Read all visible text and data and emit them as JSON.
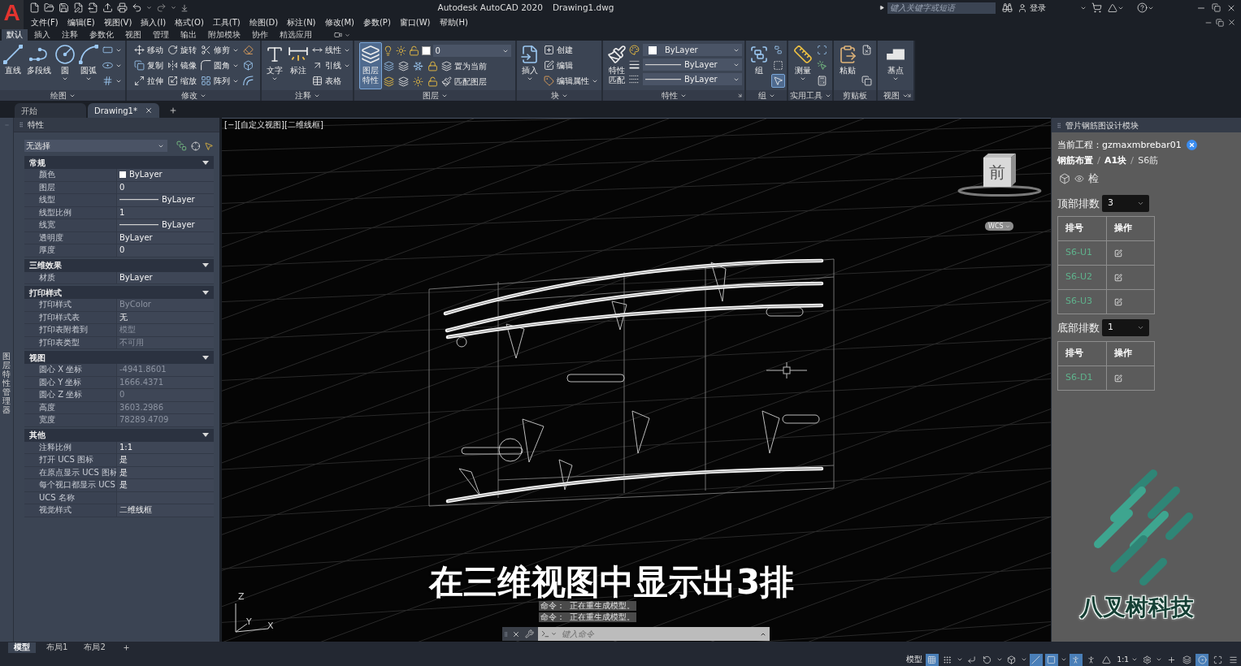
{
  "app_menu": {
    "label": "A"
  },
  "title_bar": {
    "title": "Autodesk AutoCAD 2020",
    "file_name": "Drawing1.dwg",
    "search": {
      "placeholder": "键入关键字或短语"
    },
    "sign_in": "登录"
  },
  "menu_bar": [
    "文件(F)",
    "编辑(E)",
    "视图(V)",
    "插入(I)",
    "格式(O)",
    "工具(T)",
    "绘图(D)",
    "标注(N)",
    "修改(M)",
    "参数(P)",
    "窗口(W)",
    "帮助(H)"
  ],
  "ribbon": {
    "tabs": [
      {
        "label": "默认",
        "selected": true
      },
      {
        "label": "插入",
        "selected": false
      },
      {
        "label": "注释",
        "selected": false
      },
      {
        "label": "参数化",
        "selected": false
      },
      {
        "label": "视图",
        "selected": false
      },
      {
        "label": "管理",
        "selected": false
      },
      {
        "label": "输出",
        "selected": false
      },
      {
        "label": "附加模块",
        "selected": false
      },
      {
        "label": "协作",
        "selected": false
      },
      {
        "label": "精选应用",
        "selected": false
      }
    ],
    "groups": [
      {
        "label": "绘图",
        "dropdown": true,
        "launcher": false,
        "columns": [
          {
            "kind": "large",
            "label": "直线",
            "dropdown": false,
            "selected": false
          },
          {
            "kind": "large",
            "label": "多段线",
            "dropdown": false,
            "selected": false
          },
          {
            "kind": "large",
            "label": "圆",
            "dropdown": true,
            "selected": false
          },
          {
            "kind": "large",
            "label": "圆弧",
            "dropdown": true,
            "selected": false
          },
          {
            "kind": "stack",
            "items": [
              {
                "dropdown": true
              },
              {
                "dropdown": true
              },
              {
                "dropdown": true
              }
            ]
          }
        ]
      },
      {
        "label": "修改",
        "dropdown": true,
        "launcher": false,
        "columns": [
          {
            "kind": "stack",
            "items": [
              {
                "label": "移动",
                "dropdown": false
              },
              {
                "label": "复制",
                "dropdown": false
              },
              {
                "label": "拉伸",
                "dropdown": false
              }
            ]
          },
          {
            "kind": "stack",
            "items": [
              {
                "label": "旋转",
                "dropdown": false
              },
              {
                "label": "镜像",
                "dropdown": false
              },
              {
                "label": "缩放",
                "dropdown": false
              }
            ]
          },
          {
            "kind": "stack",
            "items": [
              {
                "label": "修剪",
                "dropdown": true
              },
              {
                "label": "圆角",
                "dropdown": true
              },
              {
                "label": "阵列",
                "dropdown": true
              }
            ]
          },
          {
            "kind": "stack",
            "items": [
              {
                "dropdown": false
              },
              {
                "dropdown": false
              },
              {
                "dropdown": false
              }
            ]
          }
        ]
      },
      {
        "label": "注释",
        "dropdown": true,
        "launcher": false,
        "columns": [
          {
            "kind": "large",
            "label": "文字",
            "dropdown": true,
            "selected": false
          },
          {
            "kind": "large",
            "label": "标注",
            "dropdown": false,
            "selected": false
          },
          {
            "kind": "stack",
            "items": [
              {
                "label": "线性",
                "dropdown": true
              },
              {
                "label": "引线",
                "dropdown": true
              },
              {
                "label": "表格",
                "dropdown": false
              }
            ]
          }
        ]
      },
      {
        "label": "图层",
        "dropdown": true,
        "launcher": false,
        "columns": [
          {
            "kind": "large",
            "label": "图层特性",
            "dropdown": false,
            "selected": true
          },
          {
            "kind": "layers",
            "current": "0",
            "actions": [
              "置为当前",
              "匹配图层"
            ]
          }
        ]
      },
      {
        "label": "块",
        "dropdown": true,
        "launcher": false,
        "columns": [
          {
            "kind": "large",
            "label": "插入",
            "dropdown": true,
            "selected": false
          },
          {
            "kind": "stack",
            "items": [
              {
                "label": "创建",
                "dropdown": false
              },
              {
                "label": "编辑",
                "dropdown": false
              },
              {
                "label": "编辑属性",
                "dropdown": true
              }
            ]
          }
        ]
      },
      {
        "label": "特性",
        "dropdown": true,
        "launcher": true,
        "columns": [
          {
            "kind": "large",
            "label": "特性匹配",
            "dropdown": false,
            "selected": false
          },
          {
            "kind": "combos",
            "items": [
              {
                "kind": "color",
                "value": "ByLayer"
              },
              {
                "kind": "line",
                "value": "ByLayer"
              },
              {
                "kind": "line",
                "value": "ByLayer"
              }
            ]
          }
        ]
      },
      {
        "label": "组",
        "dropdown": true,
        "launcher": false,
        "columns": [
          {
            "kind": "large",
            "label": "组",
            "dropdown": false,
            "selected": false
          },
          {
            "kind": "stack",
            "items": [
              {
                "dropdown": false,
                "selected": false
              },
              {
                "dropdown": false,
                "selected": false
              },
              {
                "dropdown": false,
                "selected": true
              }
            ]
          }
        ]
      },
      {
        "label": "实用工具",
        "dropdown": true,
        "launcher": false,
        "columns": [
          {
            "kind": "large",
            "label": "测量",
            "dropdown": true,
            "selected": false
          },
          {
            "kind": "stack",
            "items": [
              {
                "dropdown": false
              },
              {
                "dropdown": false
              },
              {
                "dropdown": false
              }
            ]
          }
        ]
      },
      {
        "label": "剪贴板",
        "dropdown": false,
        "launcher": false,
        "columns": [
          {
            "kind": "large",
            "label": "粘贴",
            "dropdown": false,
            "selected": false
          },
          {
            "kind": "stack",
            "items": [
              {
                "dropdown": false
              },
              {
                "dropdown": false
              }
            ]
          }
        ]
      },
      {
        "label": "视图",
        "dropdown": true,
        "launcher": true,
        "columns": [
          {
            "kind": "large",
            "label": "基点",
            "dropdown": true,
            "selected": false
          }
        ]
      }
    ]
  },
  "file_tabs": [
    {
      "label": "开始",
      "selected": false,
      "closable": false
    },
    {
      "label": "Drawing1*",
      "selected": true,
      "closable": true
    }
  ],
  "side_strip": {
    "label": "图层特性管理器"
  },
  "properties": {
    "title": "特性",
    "selection": "无选择",
    "sections": [
      {
        "title": "常规",
        "expanded": true,
        "rows": [
          {
            "label": "颜色",
            "value": "ByLayer",
            "kind": "swatch",
            "disabled": false
          },
          {
            "label": "图层",
            "value": "0",
            "kind": "text",
            "disabled": false
          },
          {
            "label": "线型",
            "value": "ByLayer",
            "kind": "line",
            "disabled": false
          },
          {
            "label": "线型比例",
            "value": "1",
            "kind": "text",
            "disabled": false
          },
          {
            "label": "线宽",
            "value": "ByLayer",
            "kind": "line",
            "disabled": false
          },
          {
            "label": "透明度",
            "value": "ByLayer",
            "kind": "text",
            "disabled": false
          },
          {
            "label": "厚度",
            "value": "0",
            "kind": "text",
            "disabled": false
          }
        ]
      },
      {
        "title": "三维效果",
        "expanded": true,
        "rows": [
          {
            "label": "材质",
            "value": "ByLayer",
            "kind": "text",
            "disabled": false
          }
        ]
      },
      {
        "title": "打印样式",
        "expanded": true,
        "rows": [
          {
            "label": "打印样式",
            "value": "ByColor",
            "kind": "text",
            "disabled": true
          },
          {
            "label": "打印样式表",
            "value": "无",
            "kind": "text",
            "disabled": false
          },
          {
            "label": "打印表附着到",
            "value": "模型",
            "kind": "text",
            "disabled": true
          },
          {
            "label": "打印表类型",
            "value": "不可用",
            "kind": "text",
            "disabled": true
          }
        ]
      },
      {
        "title": "视图",
        "expanded": true,
        "rows": [
          {
            "label": "圆心 X 坐标",
            "value": "-4941.8601",
            "kind": "text",
            "disabled": true
          },
          {
            "label": "圆心 Y 坐标",
            "value": "1666.4371",
            "kind": "text",
            "disabled": true
          },
          {
            "label": "圆心 Z 坐标",
            "value": "0",
            "kind": "text",
            "disabled": true
          },
          {
            "label": "高度",
            "value": "3603.2986",
            "kind": "text",
            "disabled": true
          },
          {
            "label": "宽度",
            "value": "78289.4709",
            "kind": "text",
            "disabled": true
          }
        ]
      },
      {
        "title": "其他",
        "expanded": true,
        "rows": [
          {
            "label": "注释比例",
            "value": "1:1",
            "kind": "text",
            "disabled": false
          },
          {
            "label": "打开 UCS 图标",
            "value": "是",
            "kind": "text",
            "disabled": false
          },
          {
            "label": "在原点显示 UCS 图标",
            "value": "是",
            "kind": "text",
            "disabled": false
          },
          {
            "label": "每个视口都显示 UCS",
            "value": "是",
            "kind": "text",
            "disabled": false
          },
          {
            "label": "UCS 名称",
            "kind": "text"
          },
          {
            "label": "视觉样式",
            "value": "二维线框",
            "kind": "text",
            "disabled": false
          }
        ]
      }
    ]
  },
  "viewport": {
    "controls": [
      "[−]",
      "[自定义视图]",
      "[二维线框]"
    ],
    "view_cube": {
      "face": "前"
    },
    "wcs": "WCS",
    "ucs_axes": [
      "Z",
      "Y",
      "X"
    ],
    "subtitle": "在三维视图中显示出3排",
    "command_history": [
      "命令：  正在重生成模型。",
      "命令：  正在重生成模型。"
    ],
    "command_line": {
      "placeholder": "键入命令"
    }
  },
  "design_panel": {
    "title": "管片钢筋图设计模块",
    "project": "当前工程：gzmaxmbrebar01",
    "breadcrumb": [
      {
        "label": "钢筋布置",
        "current": false
      },
      {
        "label": "A1块",
        "current": false
      },
      {
        "label": "S6筋",
        "current": true
      }
    ],
    "check_label": "检",
    "groups": [
      {
        "label": "顶部排数",
        "value": "3",
        "columns": [
          "排号",
          "操作"
        ],
        "rows": [
          "S6-U1",
          "S6-U2",
          "S6-U3"
        ]
      },
      {
        "label": "底部排数",
        "value": "1",
        "columns": [
          "排号",
          "操作"
        ],
        "rows": [
          "S6-D1"
        ]
      }
    ],
    "logo_text": "八叉树科技"
  },
  "layout_tabs": [
    {
      "label": "模型",
      "selected": true
    },
    {
      "label": "布局1",
      "selected": false
    },
    {
      "label": "布局2",
      "selected": false
    }
  ],
  "status_bar": {
    "mode": "模型",
    "toggles": [
      {
        "on": true
      },
      {
        "on": false
      },
      {
        "on": false
      },
      {
        "on": false
      },
      {
        "on": false
      },
      {
        "on": true
      },
      {
        "on": true
      },
      {
        "on": true
      },
      {
        "on": false
      },
      {
        "on": false
      }
    ],
    "scale": "1:1",
    "tools": [
      {
        "on": false
      },
      {
        "on": false
      },
      {
        "on": false
      },
      {
        "on": true
      },
      {
        "on": false
      },
      {
        "on": false
      }
    ]
  }
}
